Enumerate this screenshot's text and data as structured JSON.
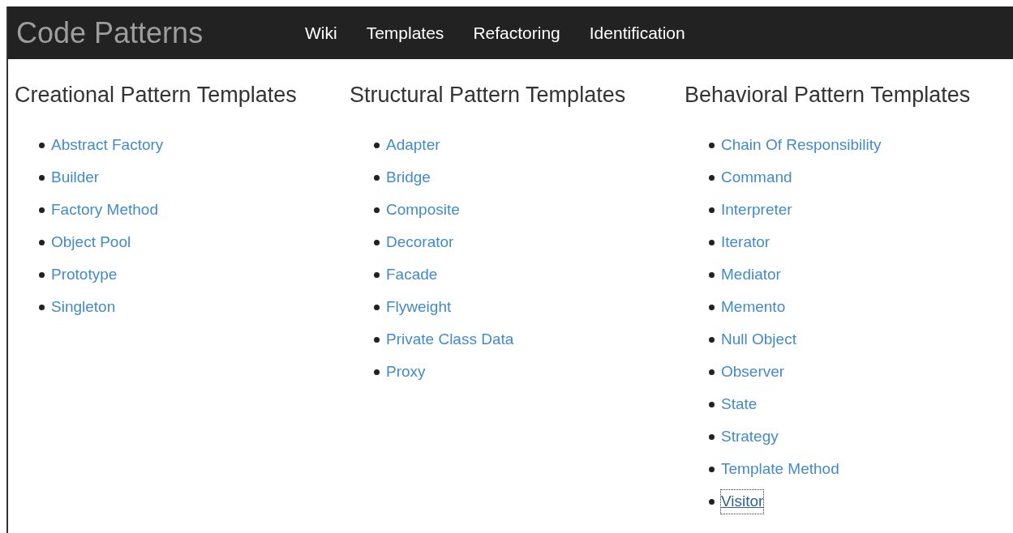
{
  "navbar": {
    "brand": "Code Patterns",
    "links": [
      {
        "label": "Wiki"
      },
      {
        "label": "Templates"
      },
      {
        "label": "Refactoring"
      },
      {
        "label": "Identification"
      }
    ]
  },
  "sections": [
    {
      "title": "Creational Pattern Templates",
      "items": [
        {
          "label": "Abstract Factory",
          "focused": false
        },
        {
          "label": "Builder",
          "focused": false
        },
        {
          "label": "Factory Method",
          "focused": false
        },
        {
          "label": "Object Pool",
          "focused": false
        },
        {
          "label": "Prototype",
          "focused": false
        },
        {
          "label": "Singleton",
          "focused": false
        }
      ]
    },
    {
      "title": "Structural Pattern Templates",
      "items": [
        {
          "label": "Adapter",
          "focused": false
        },
        {
          "label": "Bridge",
          "focused": false
        },
        {
          "label": "Composite",
          "focused": false
        },
        {
          "label": "Decorator",
          "focused": false
        },
        {
          "label": "Facade",
          "focused": false
        },
        {
          "label": "Flyweight",
          "focused": false
        },
        {
          "label": "Private Class Data",
          "focused": false
        },
        {
          "label": "Proxy",
          "focused": false
        }
      ]
    },
    {
      "title": "Behavioral Pattern Templates",
      "items": [
        {
          "label": "Chain Of Responsibility",
          "focused": false
        },
        {
          "label": "Command",
          "focused": false
        },
        {
          "label": "Interpreter",
          "focused": false
        },
        {
          "label": "Iterator",
          "focused": false
        },
        {
          "label": "Mediator",
          "focused": false
        },
        {
          "label": "Memento",
          "focused": false
        },
        {
          "label": "Null Object",
          "focused": false
        },
        {
          "label": "Observer",
          "focused": false
        },
        {
          "label": "State",
          "focused": false
        },
        {
          "label": "Strategy",
          "focused": false
        },
        {
          "label": "Template Method",
          "focused": false
        },
        {
          "label": "Visitor",
          "focused": true
        }
      ]
    }
  ]
}
